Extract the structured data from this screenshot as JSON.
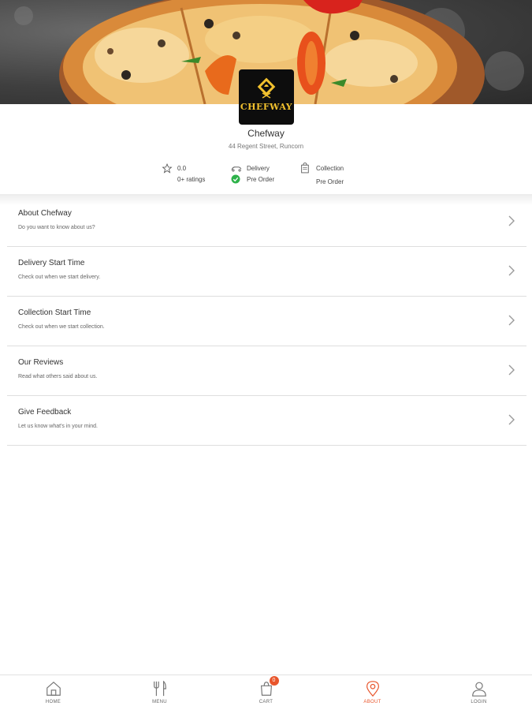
{
  "restaurant": {
    "logo_text": "CHEFWAY",
    "name": "Chefway",
    "address": "44 Regent Street, Runcorn"
  },
  "info": {
    "rating": "0.0",
    "ratings_count": "0+ ratings",
    "delivery_label": "Delivery",
    "delivery_preorder": "Pre Order",
    "collection_label": "Collection",
    "collection_preorder": "Pre Order"
  },
  "about_items": [
    {
      "title": "About Chefway",
      "description": "Do you want to know about us?"
    },
    {
      "title": "Delivery Start Time",
      "description": "Check out when we start delivery."
    },
    {
      "title": "Collection Start Time",
      "description": "Check out when we start collection."
    },
    {
      "title": "Our Reviews",
      "description": "Read what others said about us."
    },
    {
      "title": "Give Feedback",
      "description": "Let us know what's in your mind."
    }
  ],
  "nav": {
    "items": [
      {
        "label": "HOME",
        "icon": "home-icon"
      },
      {
        "label": "MENU",
        "icon": "fork-knife-icon"
      },
      {
        "label": "CART",
        "icon": "cart-icon"
      },
      {
        "label": "ABOUT",
        "icon": "location-pin-icon"
      },
      {
        "label": "LOGIN",
        "icon": "user-icon"
      }
    ],
    "cart_count": "0",
    "active": "ABOUT"
  },
  "colors": {
    "accent": "#e8552b",
    "check_green": "#2eb24a",
    "logo_gold": "#f2c12e"
  }
}
